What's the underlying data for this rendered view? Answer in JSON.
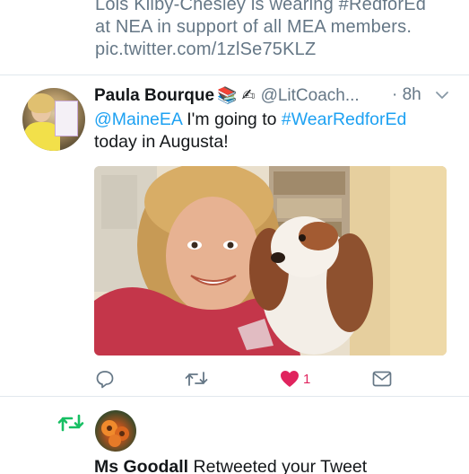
{
  "previous_tweet": {
    "lines": [
      "Lois Kilby-Chesley is wearing #RedforEd",
      "at NEA in support of all MEA members.",
      "pic.twitter.com/1zlSe75KLZ"
    ]
  },
  "tweet": {
    "display_name": "Paula Bourque",
    "emojis": "📚 ✍",
    "handle": "@LitCoach...",
    "timestamp": "· 8h",
    "text": {
      "mention": "@MaineEA",
      "middle": " I'm going to ",
      "hashtag": "#WearRedforEd",
      "end": "today in Augusta!"
    },
    "actions": {
      "reply_icon": "reply-icon",
      "retweet_icon": "retweet-icon",
      "like_icon": "heart-icon",
      "like_count": "1",
      "dm_icon": "envelope-icon"
    },
    "colors": {
      "link": "#1da1f2",
      "like": "#e0245e",
      "retweet": "#17bf63",
      "muted": "#657786"
    }
  },
  "notification": {
    "icon": "retweet-icon",
    "user": "Ms Goodall",
    "action_text": " Retweeted your Tweet"
  }
}
